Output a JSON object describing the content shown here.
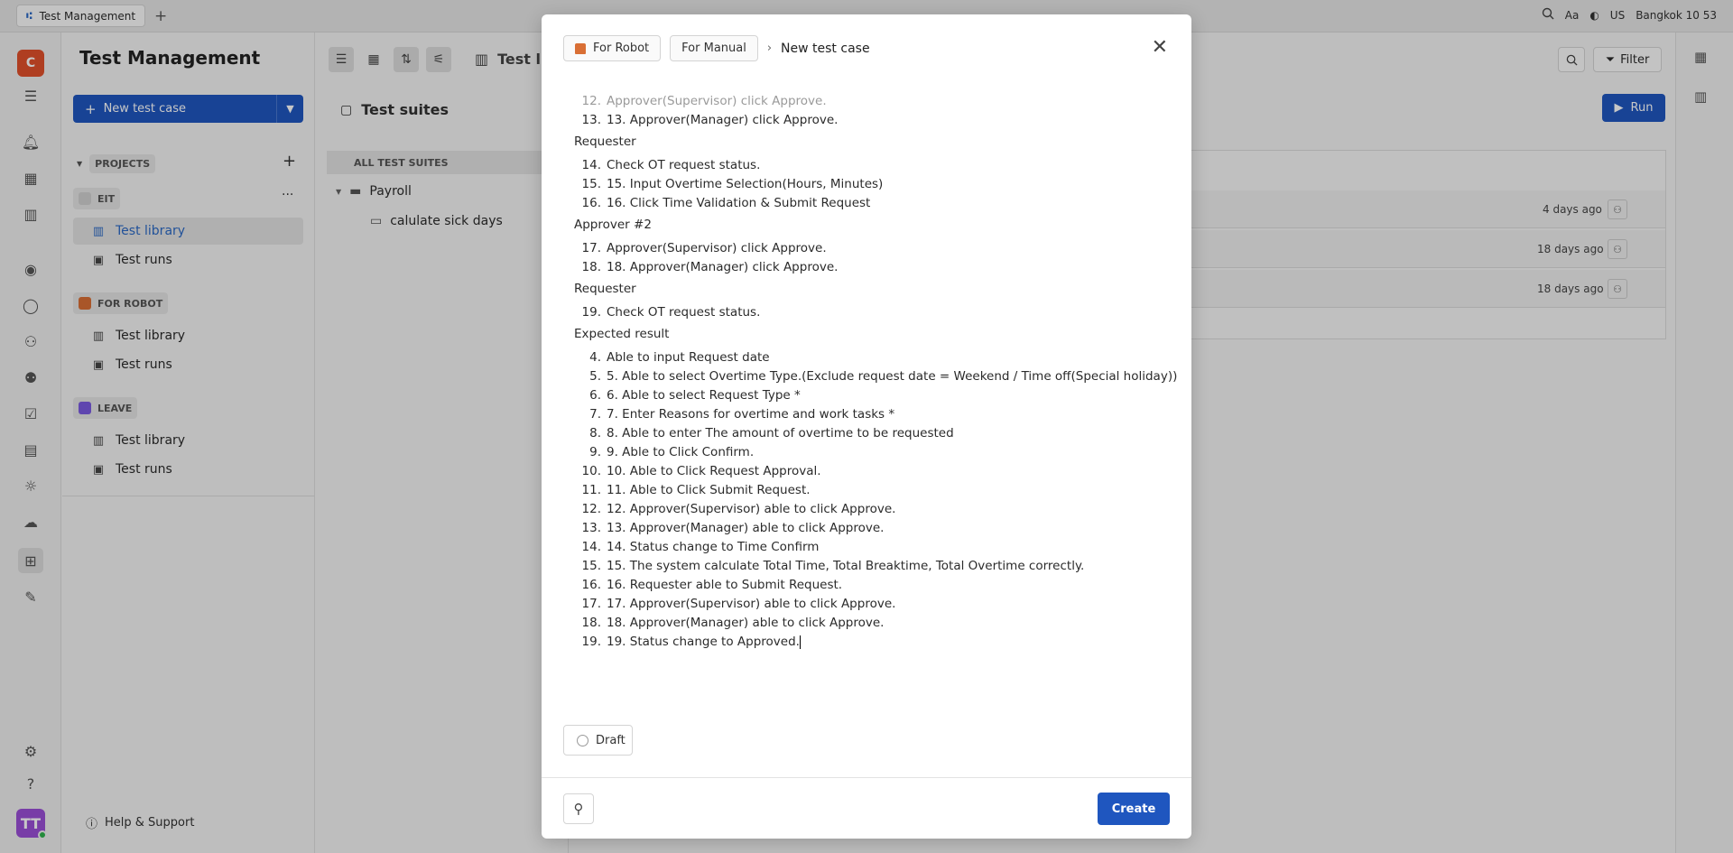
{
  "browser": {
    "tab_title": "Test Management",
    "tab_add": "+",
    "locale": "US",
    "clock": "Bangkok  10 53",
    "font_toggle": "Aa"
  },
  "rail": {
    "logo_letter": "C",
    "avatar": "TT"
  },
  "sidebar": {
    "title": "Test Management",
    "new_button": "New test case",
    "projects_label": "PROJECTS",
    "groups": [
      {
        "name": "EIT",
        "color": "#d0d0d0",
        "items": [
          "Test library",
          "Test runs"
        ]
      },
      {
        "name": "FOR ROBOT",
        "color": "#d96f35",
        "items": [
          "Test library",
          "Test runs"
        ]
      },
      {
        "name": "LEAVE",
        "color": "#7a5ae0",
        "items": [
          "Test library",
          "Test runs"
        ]
      }
    ],
    "help": "Help & Support"
  },
  "suites": {
    "header_label": "Test lib",
    "title": "Test suites",
    "all_label": "ALL TEST SUITES",
    "folders": [
      "Payroll",
      "calulate sick days"
    ]
  },
  "main": {
    "filter": "Filter",
    "run": "Run",
    "rows": [
      "4 days ago",
      "18 days ago",
      "18 days ago"
    ]
  },
  "modal": {
    "crumb_robot": "For Robot",
    "crumb_manual": "For Manual",
    "crumb_current": "New test case",
    "steps": [
      {
        "n": "12.",
        "t": "Approver(Supervisor) click Approve.",
        "faded": true
      },
      {
        "n": "13.",
        "t": "13. Approver(Manager) click Approve."
      },
      {
        "header": "Requester"
      },
      {
        "n": "14.",
        "t": "Check OT request status."
      },
      {
        "n": "15.",
        "t": "15. Input Overtime Selection(Hours, Minutes)"
      },
      {
        "n": "16.",
        "t": "16. Click Time Validation & Submit Request"
      },
      {
        "header": "Approver #2"
      },
      {
        "n": "17.",
        "t": "Approver(Supervisor) click Approve."
      },
      {
        "n": "18.",
        "t": "18. Approver(Manager) click Approve."
      },
      {
        "header": "Requester"
      },
      {
        "n": "19.",
        "t": "Check OT request status."
      },
      {
        "header": "Expected result"
      },
      {
        "n": "4.",
        "t": "Able to input Request date"
      },
      {
        "n": "5.",
        "t": "5. Able to select Overtime Type.(Exclude  request date = Weekend / Time off(Special holiday))"
      },
      {
        "n": "6.",
        "t": "6. Able to select Request Type *"
      },
      {
        "n": "7.",
        "t": "7. Enter Reasons for overtime and work tasks *"
      },
      {
        "n": "8.",
        "t": "8. Able to enter The amount of overtime to be requested"
      },
      {
        "n": "9.",
        "t": "9. Able to Click Confirm."
      },
      {
        "n": "10.",
        "t": "10. Able to Click Request Approval."
      },
      {
        "n": "11.",
        "t": "11. Able to Click Submit Request."
      },
      {
        "n": "12.",
        "t": "12. Approver(Supervisor) able to click Approve."
      },
      {
        "n": "13.",
        "t": "13. Approver(Manager) able to click Approve."
      },
      {
        "n": "14.",
        "t": "14. Status change to Time Confirm"
      },
      {
        "n": "15.",
        "t": "15. The system calculate Total Time, Total Breaktime, Total Overtime correctly."
      },
      {
        "n": "16.",
        "t": "16. Requester able to Submit Request."
      },
      {
        "n": "17.",
        "t": "17. Approver(Supervisor) able to click Approve."
      },
      {
        "n": "18.",
        "t": "18. Approver(Manager) able to click Approve."
      },
      {
        "n": "19.",
        "t": "19. Status change to Approved."
      }
    ],
    "draft": "Draft",
    "create": "Create"
  }
}
